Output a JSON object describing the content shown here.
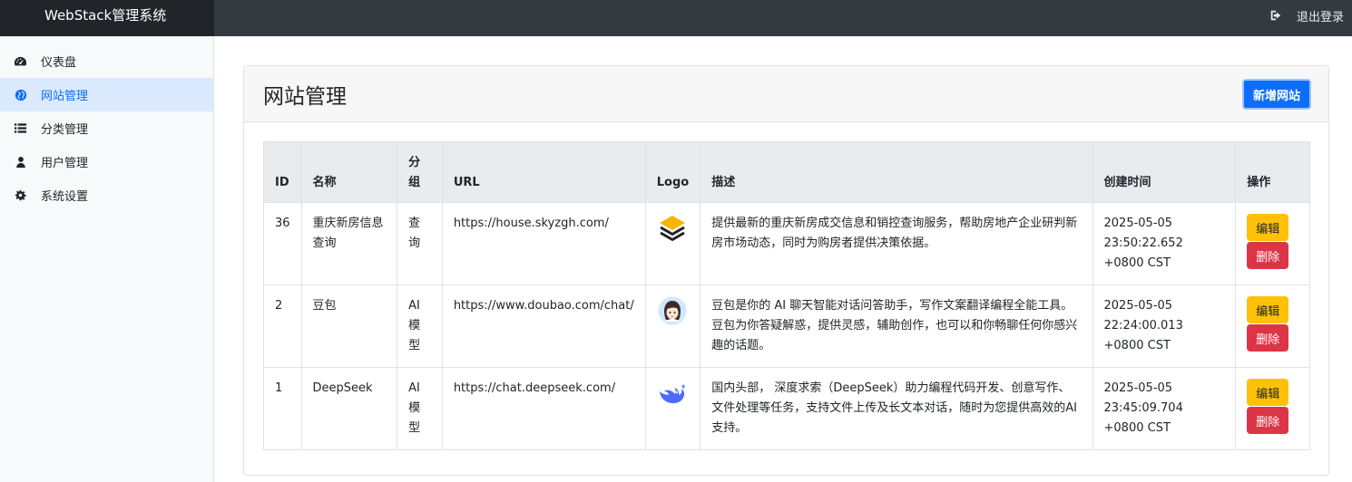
{
  "app": {
    "title": "WebStack管理系统"
  },
  "header": {
    "logout_label": "退出登录",
    "logout_icon": "sign-out-icon"
  },
  "sidebar": {
    "items": [
      {
        "label": "仪表盘",
        "icon": "dashboard-icon",
        "active": false
      },
      {
        "label": "网站管理",
        "icon": "globe-icon",
        "active": true
      },
      {
        "label": "分类管理",
        "icon": "list-icon",
        "active": false
      },
      {
        "label": "用户管理",
        "icon": "user-icon",
        "active": false
      },
      {
        "label": "系统设置",
        "icon": "gear-icon",
        "active": false
      }
    ]
  },
  "main": {
    "title": "网站管理",
    "add_button_label": "新增网站",
    "table": {
      "headers": [
        "ID",
        "名称",
        "分组",
        "URL",
        "Logo",
        "描述",
        "创建时间",
        "操作"
      ],
      "rows": [
        {
          "id": "36",
          "name": "重庆新房信息查询",
          "group": "查询",
          "url": "https://house.skyzgh.com/",
          "logo": "layers-logo",
          "description": "提供最新的重庆新房成交信息和销控查询服务，帮助房地产企业研判新房市场动态，同时为购房者提供决策依据。",
          "created": "2025-05-05 23:50:22.652 +0800 CST"
        },
        {
          "id": "2",
          "name": "豆包",
          "group": "AI模型",
          "url": "https://www.doubao.com/chat/",
          "logo": "doubao-avatar-logo",
          "description": "豆包是你的 AI 聊天智能对话问答助手，写作文案翻译编程全能工具。豆包为你答疑解惑，提供灵感，辅助创作，也可以和你畅聊任何你感兴趣的话题。",
          "created": "2025-05-05 22:24:00.013 +0800 CST"
        },
        {
          "id": "1",
          "name": "DeepSeek",
          "group": "AI模型",
          "url": "https://chat.deepseek.com/",
          "logo": "deepseek-whale-logo",
          "description": "国内头部， 深度求索（DeepSeek）助力编程代码开发、创意写作、文件处理等任务，支持文件上传及长文本对话，随时为您提供高效的AI支持。",
          "created": "2025-05-05 23:45:09.704 +0800 CST"
        }
      ],
      "edit_label": "编辑",
      "delete_label": "删除"
    }
  },
  "colors": {
    "topbar": "#343a40",
    "brand_bg": "#212529",
    "active_nav_bg": "#dbeafe",
    "primary": "#0d6efd",
    "edit": "#ffc107",
    "delete": "#dc3545"
  }
}
